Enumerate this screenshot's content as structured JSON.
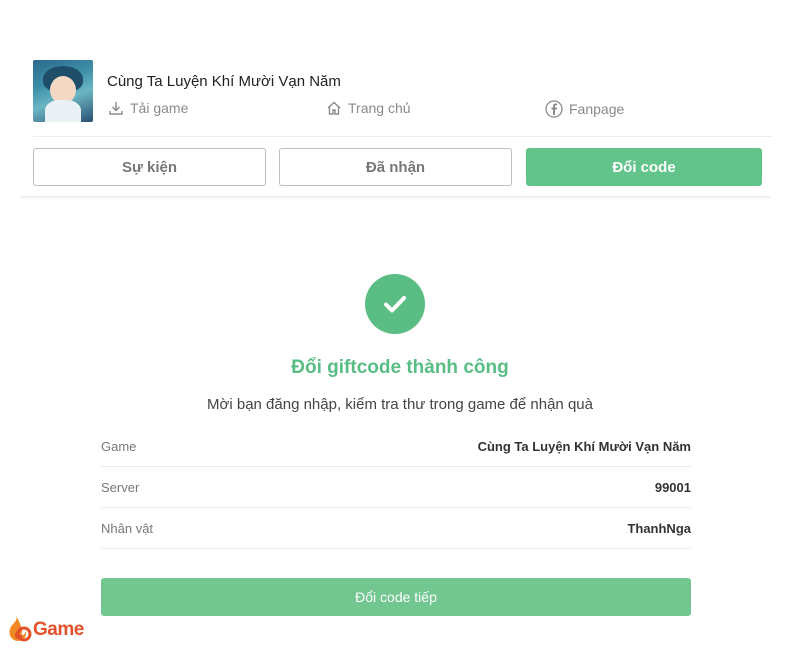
{
  "header": {
    "game_title": "Cùng Ta Luyện Khí Mười Vạn Năm",
    "download_label": "Tải game",
    "home_label": "Trang chủ",
    "fanpage_label": "Fanpage",
    "icons": [
      "download-icon",
      "home-icon",
      "facebook-icon"
    ]
  },
  "tabs": [
    {
      "label": "Sự kiện",
      "active": false
    },
    {
      "label": "Đã nhận",
      "active": false
    },
    {
      "label": "Đổi code",
      "active": true
    }
  ],
  "result": {
    "icon": "check-circle-icon",
    "title": "Đổi giftcode thành công",
    "subtitle": "Mời bạn đăng nhập, kiểm tra thư trong game để nhận quà"
  },
  "details": [
    {
      "label": "Game",
      "value": "Cùng Ta Luyện Khí Mười Vạn Năm"
    },
    {
      "label": "Server",
      "value": "99001"
    },
    {
      "label": "Nhân vật",
      "value": "ThanhNga"
    }
  ],
  "continue_button": "Đổi code tiếp",
  "brand": {
    "text": "Game",
    "icon": "flame-logo"
  },
  "colors": {
    "accent": "#62c48a",
    "brand": "#e3512a",
    "border": "#bfbfbf"
  }
}
